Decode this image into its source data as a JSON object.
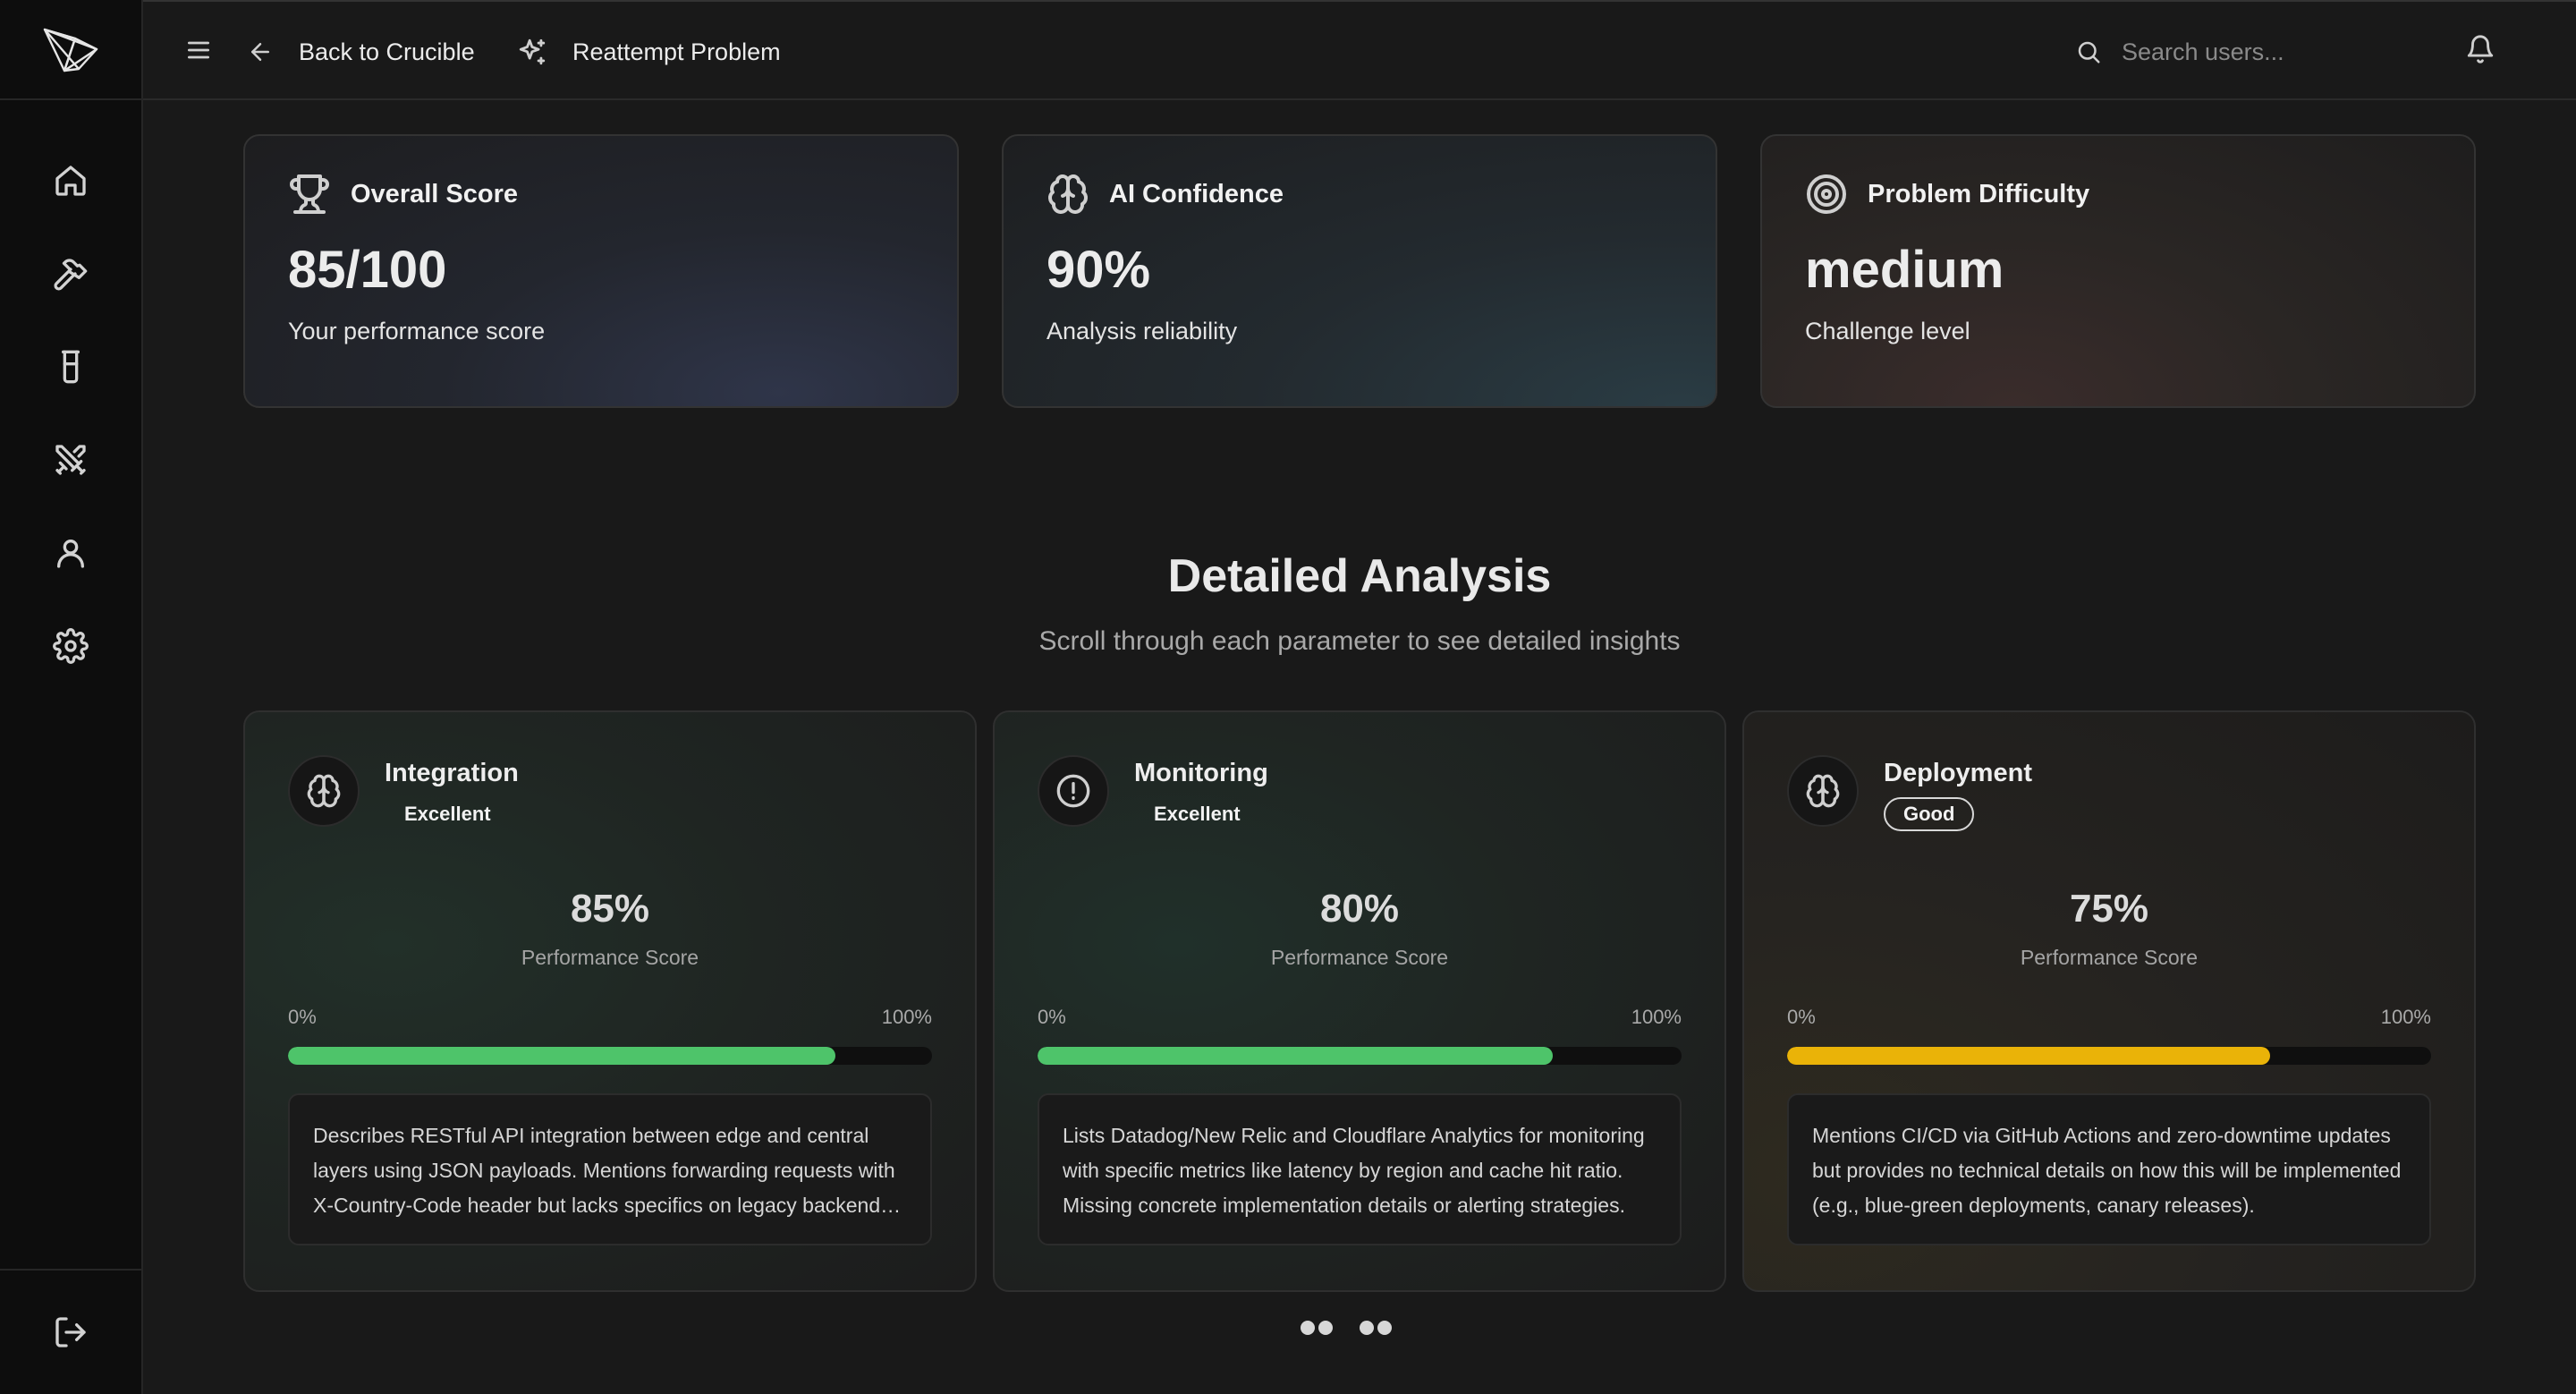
{
  "topbar": {
    "back_label": "Back to Crucible",
    "reattempt_label": "Reattempt Problem",
    "search_placeholder": "Search users..."
  },
  "sidebar": {
    "items": [
      {
        "name": "home-icon"
      },
      {
        "name": "hammer-icon"
      },
      {
        "name": "flask-icon"
      },
      {
        "name": "swords-icon"
      },
      {
        "name": "user-icon"
      },
      {
        "name": "settings-icon"
      }
    ],
    "logout_icon": "logout-icon"
  },
  "stats": [
    {
      "title": "Overall Score",
      "value": "85/100",
      "subtitle": "Your performance score",
      "icon": "trophy-icon"
    },
    {
      "title": "AI Confidence",
      "value": "90%",
      "subtitle": "Analysis reliability",
      "icon": "brain-icon"
    },
    {
      "title": "Problem Difficulty",
      "value": "medium",
      "subtitle": "Challenge level",
      "icon": "target-icon"
    }
  ],
  "analysis": {
    "title": "Detailed Analysis",
    "subtitle": "Scroll through each parameter to see detailed insights",
    "cards": [
      {
        "name": "Integration",
        "rating": "Excellent",
        "score": "85%",
        "score_value": 0.85,
        "score_label": "Performance Score",
        "min": "0%",
        "max": "100%",
        "bar_color": "#4ec46a",
        "icon": "brain-icon",
        "description": "Describes RESTful API integration between edge and central layers using JSON payloads. Mentions forwarding requests with X-Country-Code header but lacks specifics on legacy backend…"
      },
      {
        "name": "Monitoring",
        "rating": "Excellent",
        "score": "80%",
        "score_value": 0.8,
        "score_label": "Performance Score",
        "min": "0%",
        "max": "100%",
        "bar_color": "#4ec46a",
        "icon": "alert-circle-icon",
        "description": "Lists Datadog/New Relic and Cloudflare Analytics for monitoring with specific metrics like latency by region and cache hit ratio. Missing concrete implementation details or alerting strategies."
      },
      {
        "name": "Deployment",
        "rating": "Good",
        "score": "75%",
        "score_value": 0.75,
        "score_label": "Performance Score",
        "min": "0%",
        "max": "100%",
        "bar_color": "#eab308",
        "icon": "brain-icon",
        "description": "Mentions CI/CD via GitHub Actions and zero-downtime updates but provides no technical details on how this will be implemented (e.g., blue-green deployments, canary releases)."
      }
    ]
  }
}
